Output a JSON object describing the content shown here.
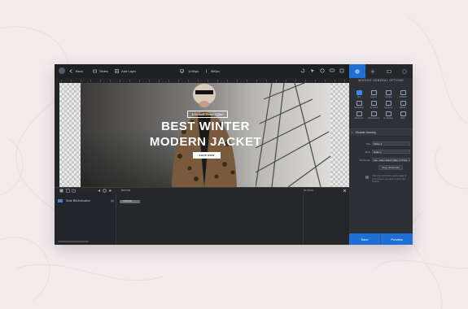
{
  "toolbar": {
    "back_label": "Back",
    "slides_label": "Slides",
    "add_layer_label": "Add Layer",
    "width_label": "1240px",
    "height_label": "960px"
  },
  "slide": {
    "tag_text": "Limited Time Offer",
    "headline_line1": "BEST WINTER",
    "headline_line2": "MODERN JACKET",
    "button_text": "SHOP NOW"
  },
  "timeline": {
    "row_label": "Slide Bill Animation",
    "block_label": "CUSTOM",
    "editor_label": "EDITOR",
    "time_label": "00:00:00"
  },
  "panel": {
    "title": "MODULE GENERAL OPTIONS",
    "grid_items": [
      "Title",
      "Layout",
      "Content",
      "Defaults",
      "Navigation",
      "On Scroll",
      "Carousel",
      "Effects",
      "Advanced",
      "Other/Layout",
      "As Module",
      "Misc"
    ],
    "section_title": "Module Naming",
    "fields": {
      "title_label": "Title",
      "title_value": "Slider 1",
      "alias_label": "Alias",
      "alias_value": "slider-1",
      "shortcode_label": "Shortcode",
      "shortcode_value": "[rev_slider alias=\"slider-1\"][/rev_slider]"
    },
    "copy_label": "Copy Shortcode",
    "help_text": "Place the shortcode via the page of your content you want to show this module",
    "save_label": "Save",
    "preview_label": "Preview"
  },
  "colors": {
    "accent": "#1f6fd6",
    "background": "#f3eced",
    "app_dark": "#2b2d31"
  }
}
